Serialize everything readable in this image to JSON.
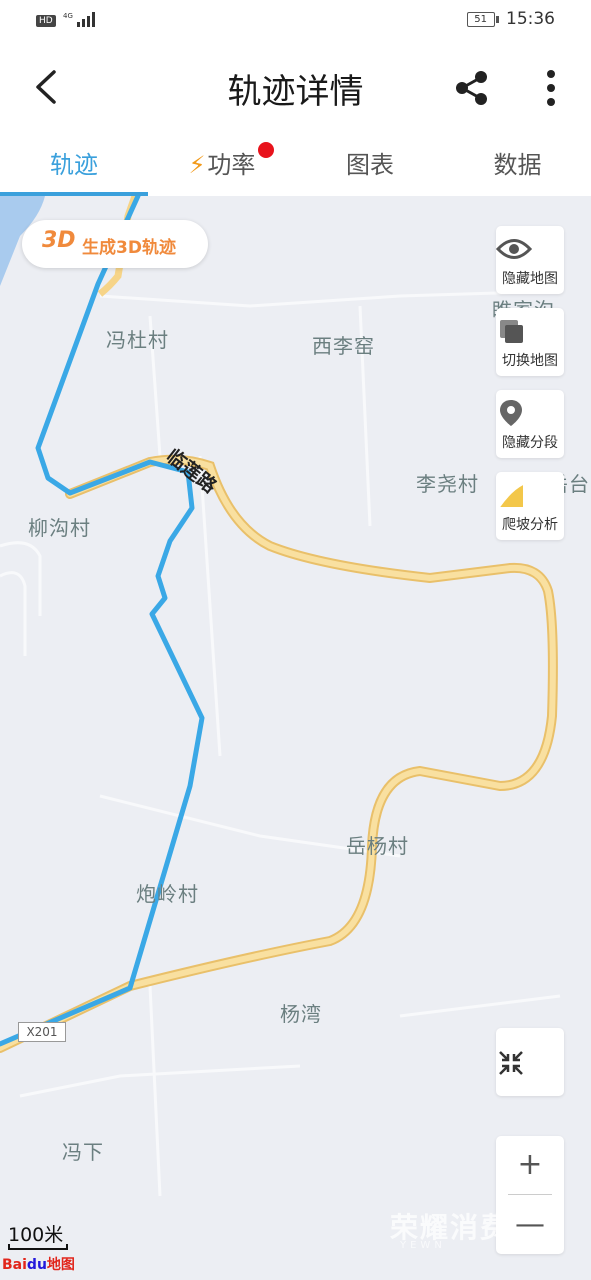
{
  "status_bar": {
    "network": "HD",
    "signal_label": "4G",
    "battery": "51",
    "time": "15:36"
  },
  "header": {
    "title": "轨迹详情",
    "back_icon": "back-arrow-icon",
    "share_icon": "share-icon",
    "more_icon": "more-vertical-icon"
  },
  "tabs": [
    {
      "label": "轨迹",
      "active": true
    },
    {
      "label": "功率",
      "icon": "bolt-icon",
      "badge": "red-dot"
    },
    {
      "label": "图表"
    },
    {
      "label": "数据"
    }
  ],
  "colors": {
    "accent": "#3aa0dc",
    "track": "#3aa8e6",
    "road": "#f6d488",
    "badge": "#e8131c",
    "bolt": "#f29a1a",
    "gen3d": "#f08a3c"
  },
  "map": {
    "generate_3d": {
      "prefix": "3D",
      "label": "生成3D轨迹"
    },
    "controls": [
      {
        "label": "隐藏地图",
        "icon": "eye-icon"
      },
      {
        "label": "切换地图",
        "icon": "layers-icon"
      },
      {
        "label": "隐藏分段",
        "icon": "location-pin-icon"
      },
      {
        "label": "爬坡分析",
        "icon": "slope-icon"
      }
    ],
    "places": [
      "冯杜村",
      "西李窑",
      "柳沟村",
      "李尧村",
      "岳杨村",
      "炮岭村",
      "杨湾",
      "冯下",
      "睢家沟",
      "岳台"
    ],
    "road_name": "临莲路",
    "road_tag": "X201",
    "zoom_in": "+",
    "zoom_out": "—",
    "collapse_icon": "collapse-arrows-icon",
    "scale": "100米",
    "logo": {
      "bai": "Bai",
      "du": "du",
      "map": "地图"
    },
    "watermark": "荣耀消费",
    "watermark_sub": "YEWN"
  }
}
